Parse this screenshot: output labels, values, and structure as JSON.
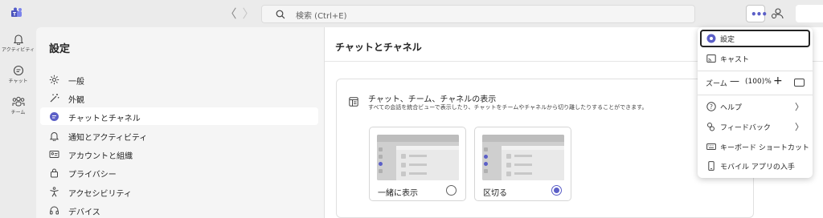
{
  "topbar": {
    "search_placeholder": "検索 (Ctrl+E)",
    "back_arrow": "〈",
    "forward_arrow": "〉",
    "more_glyph": "•••"
  },
  "rail": {
    "items": [
      {
        "label": "アクティビティ",
        "icon": "bell-icon"
      },
      {
        "label": "チャット",
        "icon": "chat-icon"
      },
      {
        "label": "チーム",
        "icon": "teams-icon"
      }
    ]
  },
  "settings": {
    "title": "設定",
    "items": [
      {
        "label": "一般",
        "icon": "gear-icon"
      },
      {
        "label": "外観",
        "icon": "wand-icon"
      },
      {
        "label": "チャットとチャネル",
        "icon": "chat-icon",
        "active": true
      },
      {
        "label": "通知とアクティビティ",
        "icon": "bell-icon"
      },
      {
        "label": "アカウントと組織",
        "icon": "id-card-icon"
      },
      {
        "label": "プライバシー",
        "icon": "lock-icon"
      },
      {
        "label": "アクセシビリティ",
        "icon": "accessibility-icon"
      },
      {
        "label": "デバイス",
        "icon": "headset-icon"
      }
    ]
  },
  "main": {
    "title": "チャットとチャネル",
    "section": {
      "title": "チャット、チーム、チャネルの表示",
      "description": "すべての会話を統合ビューで表示したり、チャットをチームやチャネルから切り離したりすることができます。",
      "options": [
        {
          "label": "一緒に表示",
          "selected": false
        },
        {
          "label": "区切る",
          "selected": true
        }
      ]
    }
  },
  "menu": {
    "items": [
      {
        "label": "設定",
        "icon": "gear-icon"
      },
      {
        "label": "キャスト",
        "icon": "cast-icon"
      },
      {
        "label": "ヘルプ",
        "icon": "help-icon"
      },
      {
        "label": "フィードバック",
        "icon": "feedback-icon"
      },
      {
        "label": "キーボード ショートカット",
        "icon": "keyboard-icon"
      },
      {
        "label": "モバイル アプリの入手",
        "icon": "phone-icon"
      }
    ],
    "zoom": {
      "label": "ズーム",
      "minus": "—",
      "value": "(100)%",
      "plus": "+"
    },
    "chevron": "〉"
  },
  "colors": {
    "accent": "#5b5fc7",
    "background": "#ebebeb",
    "panel": "#f5f5f5"
  }
}
